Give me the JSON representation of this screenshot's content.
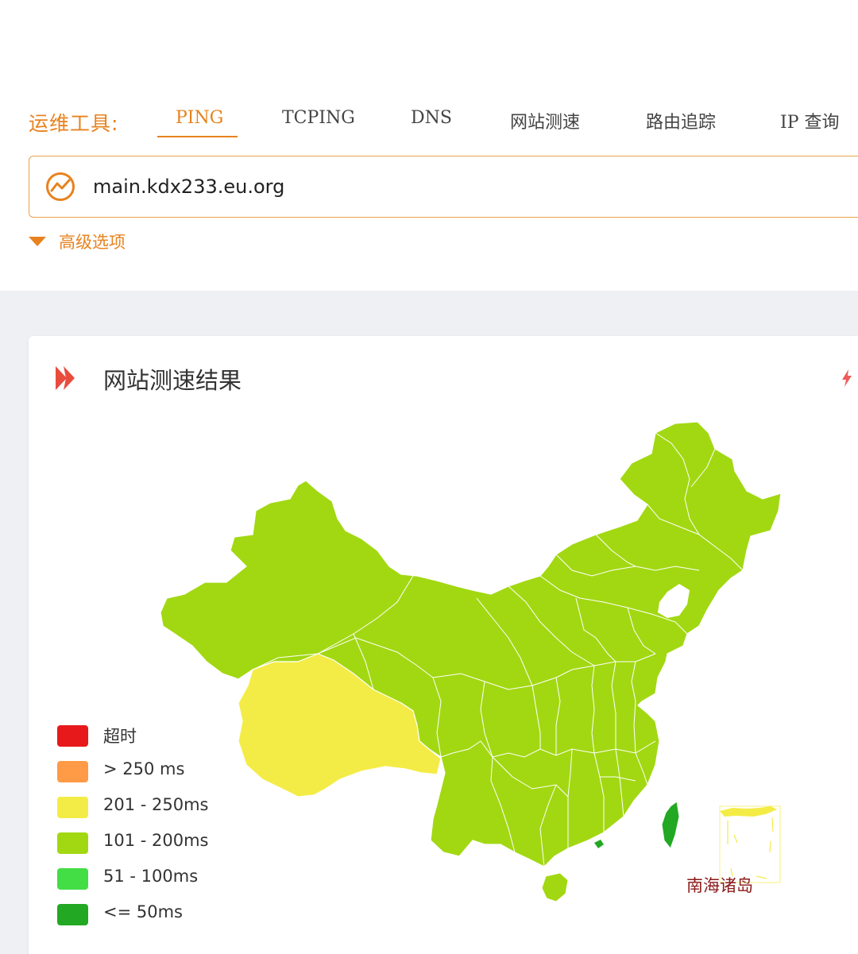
{
  "toolbar": {
    "label": "运维工具:",
    "tabs": [
      {
        "label": "PING",
        "active": true
      },
      {
        "label": "TCPING",
        "active": false
      },
      {
        "label": "DNS",
        "active": false
      },
      {
        "label": "网站测速",
        "active": false
      },
      {
        "label": "路由追踪",
        "active": false
      },
      {
        "label": "IP 查询",
        "active": false
      }
    ]
  },
  "target": {
    "value": "main.kdx233.eu.org",
    "icon": "trend-line-icon"
  },
  "advanced": {
    "label": "高级选项",
    "icon": "caret-down-icon"
  },
  "result": {
    "title": "网站测速结果",
    "icon": "double-chevron-right-icon",
    "action_icon": "lightning-icon"
  },
  "map": {
    "islands_label": "南海诸岛",
    "regions": {
      "mainland": "101 - 200ms",
      "tibet": "201 - 250ms",
      "taiwan": "<= 50ms",
      "hong_kong": "<= 50ms",
      "hainan": "101 - 200ms",
      "south_china_sea_islands": "201 - 250ms"
    }
  },
  "legend": [
    {
      "label": "超时",
      "color": "#e8191a"
    },
    {
      "label": "> 250 ms",
      "color": "#ff9a46"
    },
    {
      "label": "201 - 250ms",
      "color": "#f4ec46"
    },
    {
      "label": "101 - 200ms",
      "color": "#a2d812"
    },
    {
      "label": "51 - 100ms",
      "color": "#43dd45"
    },
    {
      "label": "<= 50ms",
      "color": "#23a823"
    }
  ],
  "colors": {
    "accent": "#e8821e",
    "title_icon": "#e84c3d",
    "island_label": "#8b1a1a"
  }
}
